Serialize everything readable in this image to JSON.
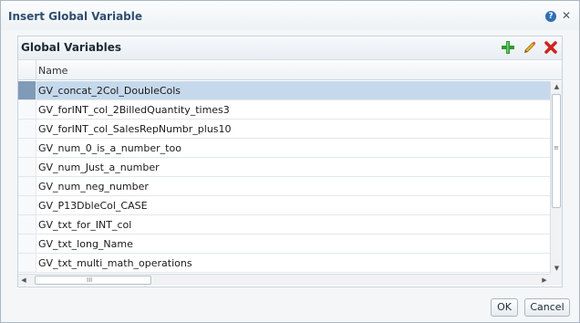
{
  "dialog": {
    "title": "Insert Global Variable",
    "help_icon": "help-icon",
    "close_icon": "close-icon"
  },
  "panel": {
    "title": "Global Variables",
    "toolbar": {
      "add_icon": "plus-icon",
      "edit_icon": "pencil-icon",
      "delete_icon": "x-icon",
      "colors": {
        "add": "#2e9b2e",
        "edit": "#d79b1a",
        "delete": "#d0231c"
      }
    }
  },
  "table": {
    "columns": [
      "Name"
    ],
    "rows": [
      {
        "name": "GV_concat_2Col_DoubleCols",
        "selected": true
      },
      {
        "name": "GV_forINT_col_2BilledQuantity_times3"
      },
      {
        "name": "GV_forINT_col_SalesRepNumbr_plus10"
      },
      {
        "name": "GV_num_0_is_a_number_too"
      },
      {
        "name": "GV_num_Just_a_number"
      },
      {
        "name": "GV_num_neg_number"
      },
      {
        "name": "GV_P13DbleCol_CASE"
      },
      {
        "name": "GV_txt_for_INT_col"
      },
      {
        "name": "GV_txt_long_Name"
      },
      {
        "name": "GV_txt_multi_math_operations"
      }
    ],
    "selected_color": "#c6d9ec"
  },
  "buttons": {
    "ok": "OK",
    "cancel": "Cancel"
  }
}
